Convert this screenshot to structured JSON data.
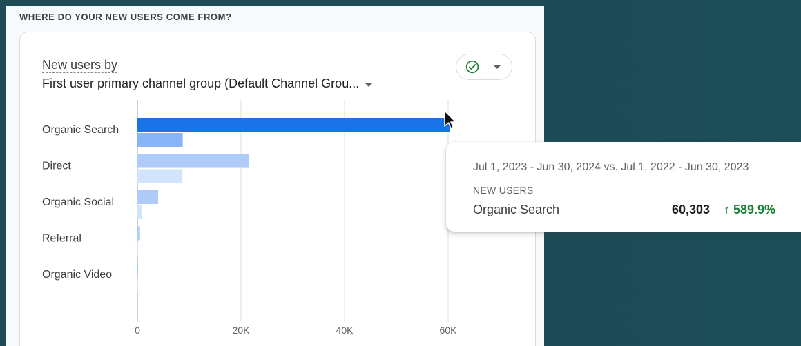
{
  "panel": {
    "section_title": "WHERE DO YOUR NEW USERS COME FROM?"
  },
  "card": {
    "heading_line_1": "New users by",
    "heading_line_2": "First user primary channel group (Default Channel Grou...",
    "status_icon": "check-circle-icon",
    "dropdown_icon": "chevron-down-icon"
  },
  "tooltip": {
    "date_range": "Jul 1, 2023 - Jun 30, 2024 vs. Jul 1, 2022 - Jun 30, 2023",
    "metric": "NEW USERS",
    "label": "Organic Search",
    "value": "60,303",
    "change": "↑ 589.9%"
  },
  "colors": {
    "current": "#1a73e8",
    "previous": "#8ab4f8",
    "current_light": "#aecbfa",
    "previous_light": "#d2e3fc",
    "positive": "#188038"
  },
  "chart_data": {
    "type": "bar",
    "orientation": "horizontal",
    "categories": [
      "Organic Search",
      "Direct",
      "Organic Social",
      "Referral",
      "Organic Video"
    ],
    "series": [
      {
        "values": [
          60303,
          21500,
          4000,
          500,
          120
        ]
      },
      {
        "values": [
          8750,
          8700,
          900,
          80,
          40
        ]
      }
    ],
    "x_ticks": [
      "0",
      "20K",
      "40K",
      "60K"
    ],
    "x_tick_values": [
      0,
      20000,
      40000,
      60000
    ],
    "xlim": [
      0,
      60000
    ],
    "grid": true,
    "legend": "none"
  }
}
